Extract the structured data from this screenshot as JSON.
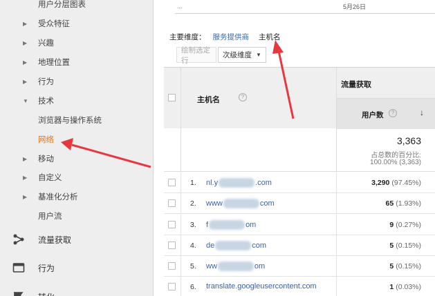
{
  "sidebar": {
    "items": [
      {
        "label": "用户分层图表",
        "caret": ""
      },
      {
        "label": "受众特征",
        "caret": "▶"
      },
      {
        "label": "兴趣",
        "caret": "▶"
      },
      {
        "label": "地理位置",
        "caret": "▶"
      },
      {
        "label": "行为",
        "caret": "▶"
      },
      {
        "label": "技术",
        "caret": "▼"
      },
      {
        "label": "浏览器与操作系统",
        "caret": ""
      },
      {
        "label": "网络",
        "caret": "",
        "active": true
      },
      {
        "label": "移动",
        "caret": "▶"
      },
      {
        "label": "自定义",
        "caret": "▶"
      },
      {
        "label": "基准化分析",
        "caret": "▶"
      },
      {
        "label": "用户流",
        "caret": ""
      }
    ],
    "sections": [
      {
        "label": "流量获取",
        "icon": "acquisition-icon"
      },
      {
        "label": "行为",
        "icon": "behavior-icon"
      },
      {
        "label": "转化",
        "icon": "conversion-icon"
      }
    ]
  },
  "topbar": {
    "dots": "...",
    "date": "5月26日"
  },
  "dimensions": {
    "label": "主要维度：",
    "option": "服务提供商",
    "current": "主机名"
  },
  "buttons": {
    "plot": "绘制选定行",
    "secondary": "次级维度"
  },
  "table": {
    "host_header": "主机名",
    "group_header": "流量获取",
    "users_header": "用户数",
    "help": "?",
    "sort": "↓",
    "total": {
      "value": "3,363",
      "label": "占总数的百分比:",
      "pct": "100.00% (3,363)"
    },
    "rows": [
      {
        "num": "1.",
        "pre": "nl.y",
        "post": ".com",
        "value": "3,290",
        "pct": "(97.45%)"
      },
      {
        "num": "2.",
        "pre": "www",
        "post": "com",
        "value": "65",
        "pct": "(1.93%)"
      },
      {
        "num": "3.",
        "pre": "f",
        "post": "om",
        "value": "9",
        "pct": "(0.27%)"
      },
      {
        "num": "4.",
        "pre": "de",
        "post": "com",
        "value": "5",
        "pct": "(0.15%)"
      },
      {
        "num": "5.",
        "pre": "ww",
        "post": "om",
        "value": "5",
        "pct": "(0.15%)"
      },
      {
        "num": "6.",
        "pre": "translate.googleusercontent.com",
        "post": "",
        "value": "1",
        "pct": "(0.03%)"
      }
    ]
  },
  "colors": {
    "accent": "#e8731c",
    "link": "#3a5fa8",
    "arrow": "#e8383d"
  }
}
